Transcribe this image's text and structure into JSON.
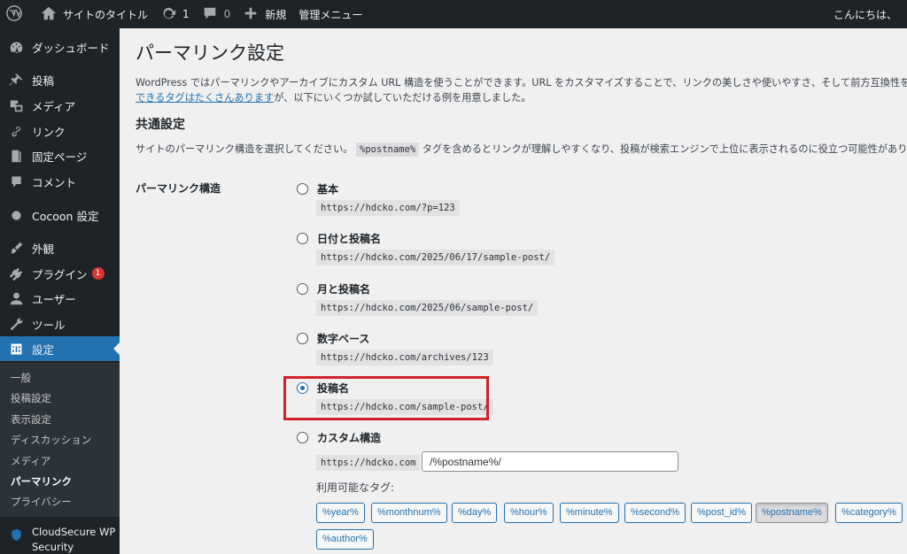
{
  "adminbar": {
    "site_title": "サイトのタイトル",
    "updates_count": "1",
    "comments_count": "0",
    "new_label": "新規",
    "admin_menu_label": "管理メニュー",
    "greeting": "こんにちは、"
  },
  "sidebar": {
    "items": [
      {
        "label": "ダッシュボード",
        "icon": "dashboard-icon"
      },
      {
        "label": "投稿",
        "icon": "pin-icon"
      },
      {
        "label": "メディア",
        "icon": "media-icon"
      },
      {
        "label": "リンク",
        "icon": "link-icon"
      },
      {
        "label": "固定ページ",
        "icon": "page-icon"
      },
      {
        "label": "コメント",
        "icon": "comment-icon"
      },
      {
        "label": "Cocoon 設定",
        "icon": "circle-icon"
      },
      {
        "label": "外観",
        "icon": "brush-icon"
      },
      {
        "label": "プラグイン",
        "icon": "plugin-icon",
        "badge": "1"
      },
      {
        "label": "ユーザー",
        "icon": "user-icon"
      },
      {
        "label": "ツール",
        "icon": "wrench-icon"
      },
      {
        "label": "設定",
        "icon": "settings-icon"
      }
    ],
    "submenu": [
      "一般",
      "投稿設定",
      "表示設定",
      "ディスカッション",
      "メディア",
      "パーマリンク",
      "プライバシー"
    ],
    "cloudsecure_line1": "CloudSecure WP",
    "cloudsecure_line2": "Security"
  },
  "main": {
    "title": "パーマリンク設定",
    "intro_line1": "WordPress ではパーマリンクやアーカイブにカスタム URL 構造を使うことができます。URL をカスタマイズすることで、リンクの美しさや使いやすさ、そして前方互換性を改善でき",
    "intro_link": "できるタグはたくさんあります",
    "intro_line2_rest": "が、以下にいくつか試していただける例を用意しました。",
    "common_heading": "共通設定",
    "desc_before": "サイトのパーマリンク構造を選択してください。",
    "desc_code": "%postname%",
    "desc_after": " タグを含めるとリンクが理解しやすくなり、投稿が検索エンジンで上位に表示されるのに役立つ可能性があります。",
    "field_label": "パーマリンク構造",
    "options": [
      {
        "label": "基本",
        "example": "https://hdcko.com/?p=123",
        "checked": false
      },
      {
        "label": "日付と投稿名",
        "example": "https://hdcko.com/2025/06/17/sample-post/",
        "checked": false
      },
      {
        "label": "月と投稿名",
        "example": "https://hdcko.com/2025/06/sample-post/",
        "checked": false
      },
      {
        "label": "数字ベース",
        "example": "https://hdcko.com/archives/123",
        "checked": false
      },
      {
        "label": "投稿名",
        "example": "https://hdcko.com/sample-post/",
        "checked": true
      },
      {
        "label": "カスタム構造",
        "checked": false
      }
    ],
    "custom_prefix": "https://hdcko.com",
    "custom_value": "/%postname%/",
    "available_tags_label": "利用可能なタグ:",
    "tags": [
      "%year%",
      "%monthnum%",
      "%day%",
      "%hour%",
      "%minute%",
      "%second%",
      "%post_id%",
      "%postname%",
      "%category%",
      "%author%"
    ],
    "active_tag": "%postname%"
  },
  "colors": {
    "adminbar_bg": "#1d2327",
    "accent": "#2271b1",
    "highlight_box": "#d1232a",
    "badge": "#d63638"
  }
}
